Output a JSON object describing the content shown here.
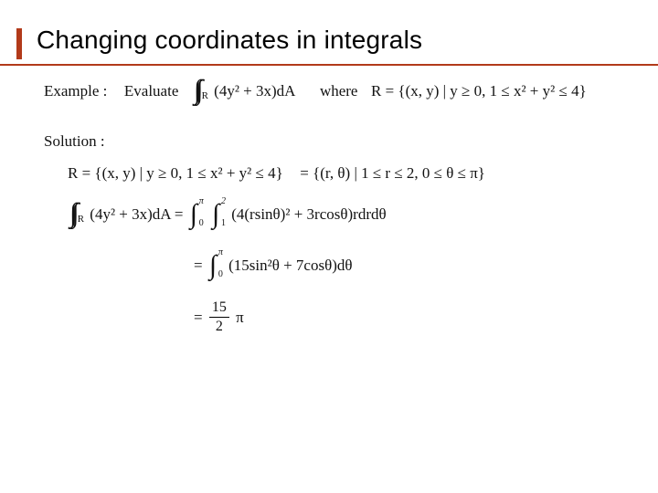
{
  "title": "Changing coordinates in integrals",
  "example": {
    "label": "Example :",
    "evaluate_word": "Evaluate",
    "iint_region": "R",
    "integrand": "(4y² + 3x)dA",
    "where_word": "where",
    "region_text": "R = {(x, y) | y ≥ 0, 1 ≤ x² + y² ≤ 4}"
  },
  "solution": {
    "label": "Solution :",
    "line1_left": "R = {(x, y) | y ≥ 0, 1 ≤ x² + y² ≤ 4}",
    "line1_right": "= {(r, θ) | 1 ≤ r ≤ 2, 0 ≤ θ ≤ π}",
    "line2_lhs_integrand": "(4y² + 3x)dA =",
    "line2_outer_lo": "0",
    "line2_outer_up": "π",
    "line2_inner_lo": "1",
    "line2_inner_up": "2",
    "line2_rhs": "(4(rsinθ)² + 3rcosθ)rdrdθ",
    "line3_lo": "0",
    "line3_up": "π",
    "line3_body": "(15sin²θ + 7cosθ)dθ",
    "line4_num": "15",
    "line4_den": "2",
    "line4_tail": "π",
    "eq": "="
  }
}
